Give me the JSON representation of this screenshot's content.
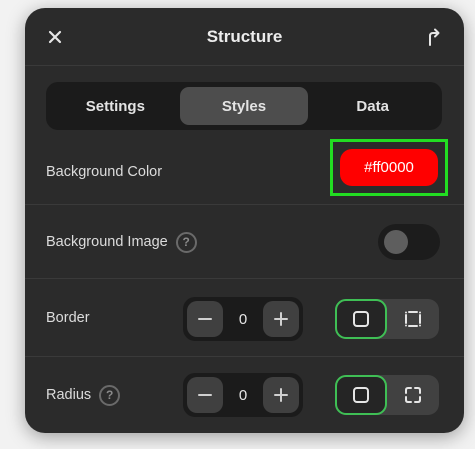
{
  "header": {
    "title": "Structure",
    "close_icon": "close-icon",
    "export_icon": "share-arrow-icon"
  },
  "tabs": [
    {
      "label": "Settings",
      "active": false
    },
    {
      "label": "Styles",
      "active": true
    },
    {
      "label": "Data",
      "active": false
    }
  ],
  "background_color": {
    "label": "Background Color",
    "value": "#ff0000",
    "display": "#ff0000"
  },
  "background_image": {
    "label": "Background Image",
    "help": "?",
    "enabled": false
  },
  "border": {
    "label": "Border",
    "value": "0",
    "modes": [
      "all-sides-icon",
      "individual-sides-icon"
    ],
    "selected_mode": "all-sides-icon"
  },
  "radius": {
    "label": "Radius",
    "help": "?",
    "value": "0",
    "modes": [
      "all-corners-icon",
      "individual-corners-icon"
    ],
    "selected_mode": "all-corners-icon"
  },
  "colors": {
    "panel": "#2b2b2b",
    "accent_green": "#3fbf55",
    "highlight_outline": "#22dd22",
    "swatch": "#ff0000"
  }
}
